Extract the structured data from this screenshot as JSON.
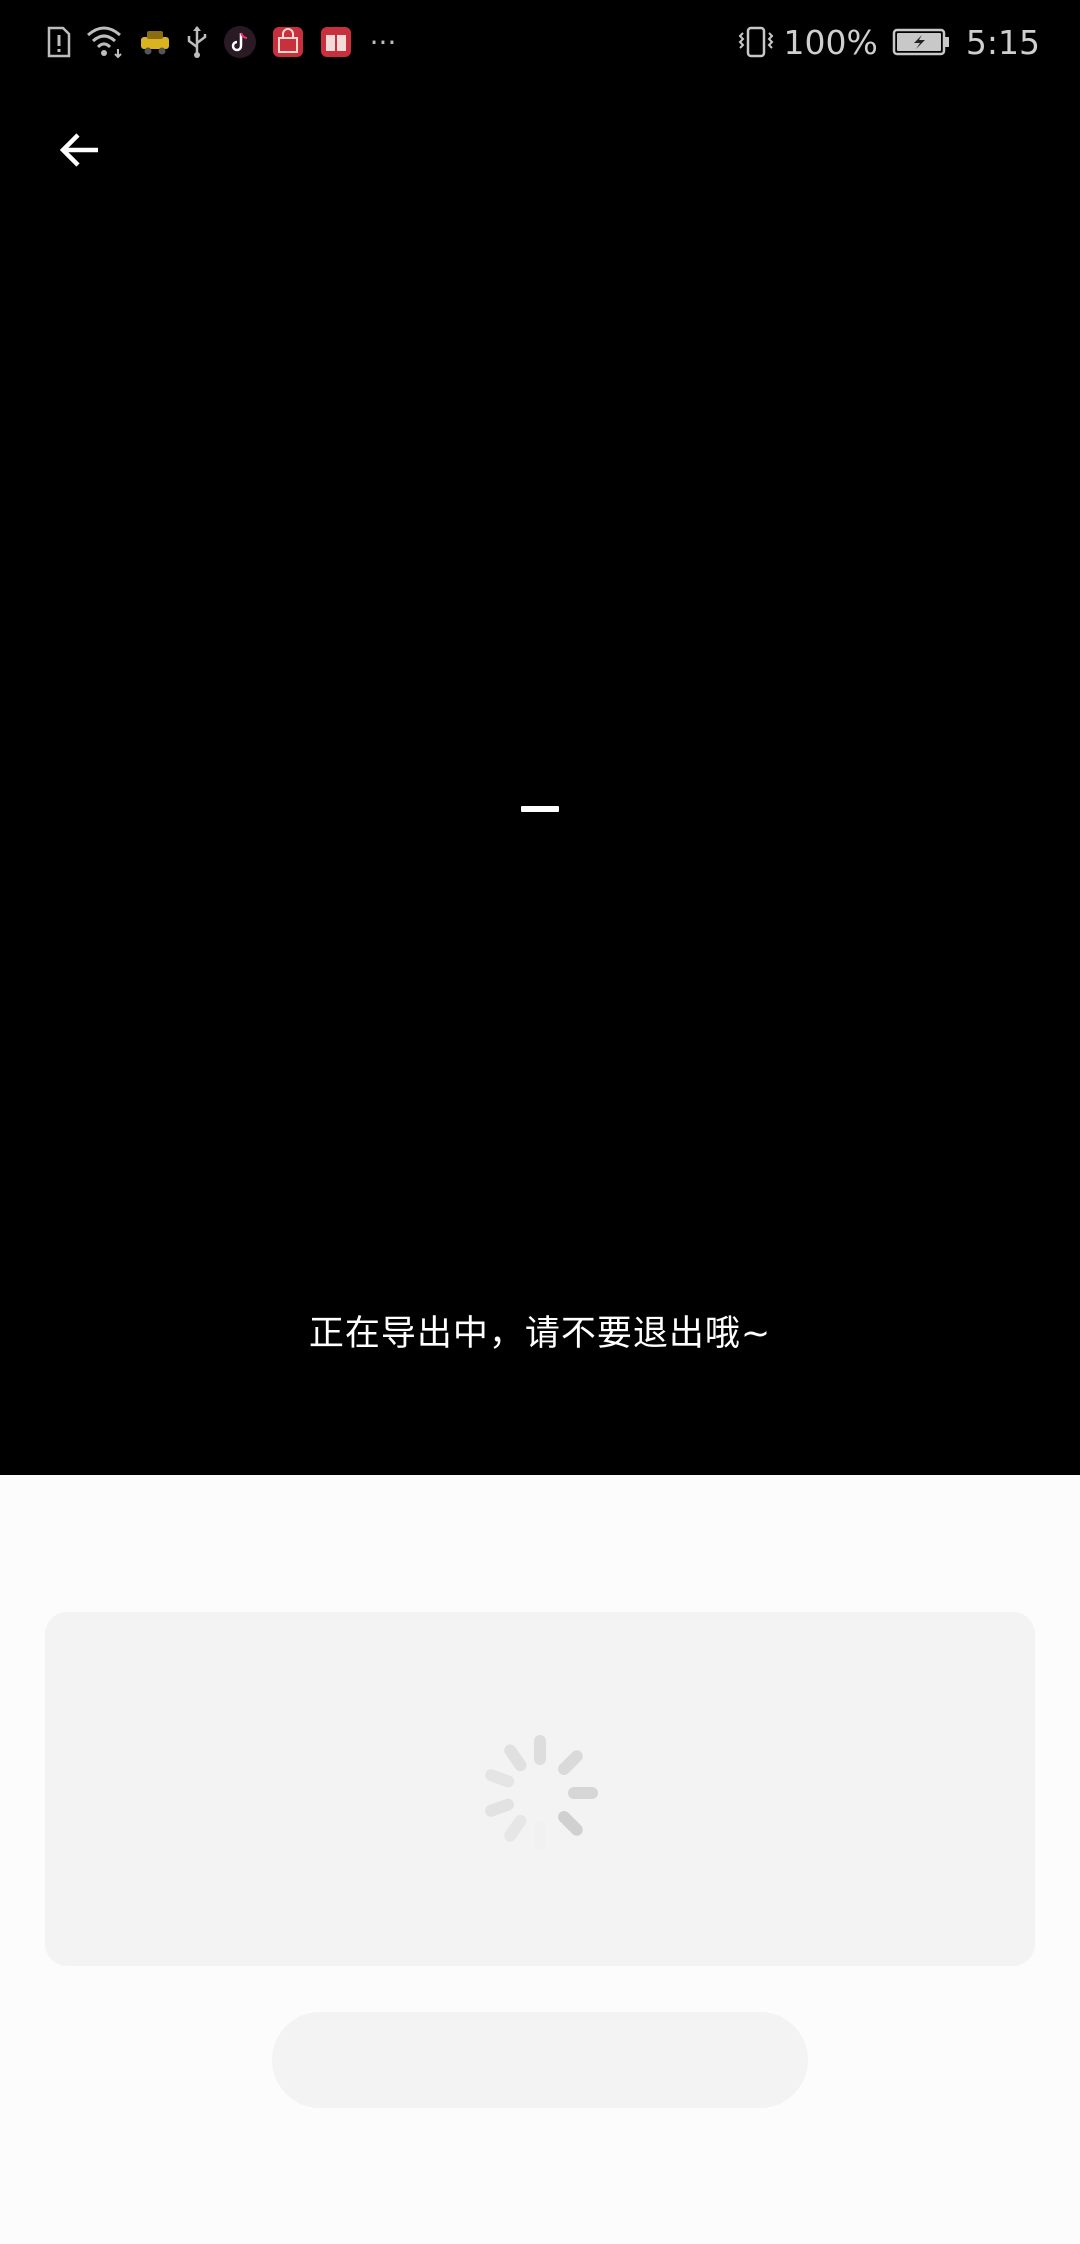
{
  "status_bar": {
    "left_icons": [
      "sim-alert-icon",
      "wifi-icon",
      "taxi-app-icon",
      "usb-icon",
      "tiktok-app-icon",
      "shopping-app-icon",
      "book-app-icon",
      "more-notifications-icon"
    ],
    "overflow_dots": "···",
    "battery_percent": "100%",
    "time": "5:15"
  },
  "export": {
    "message": "正在导出中，请不要退出哦~"
  }
}
